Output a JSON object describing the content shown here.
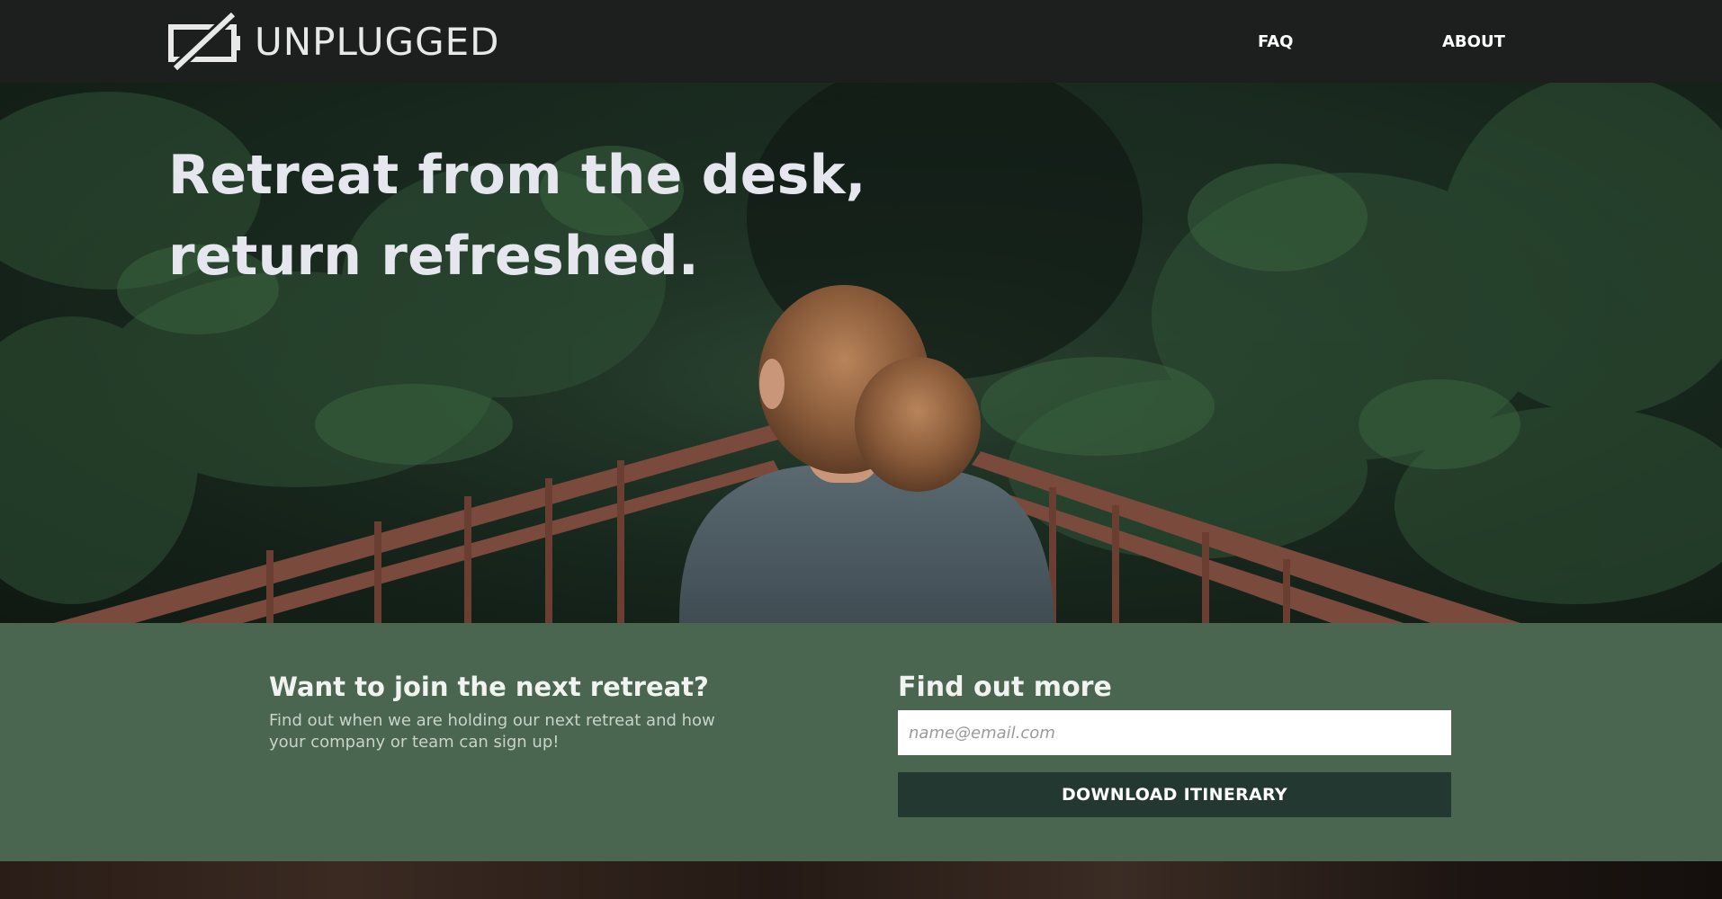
{
  "nav": {
    "brand": "UNPLUGGED",
    "links": [
      {
        "label": "FAQ"
      },
      {
        "label": "ABOUT"
      }
    ],
    "logo_icon": "battery-slash-icon"
  },
  "hero": {
    "title": "Retreat from the desk, return refreshed.",
    "image": "woman-on-forest-bridge-photo"
  },
  "signup": {
    "heading": "Want to join the next retreat?",
    "description": "Find out when we are holding our next retreat and how your company or team can sign up!",
    "form_heading": "Find out more",
    "email_placeholder": "name@email.com",
    "email_value": "",
    "button_label": "DOWNLOAD ITINERARY"
  },
  "colors": {
    "nav_bg": "#1d1e1e",
    "band_bg": "#4a6650",
    "button_bg": "#223830"
  }
}
